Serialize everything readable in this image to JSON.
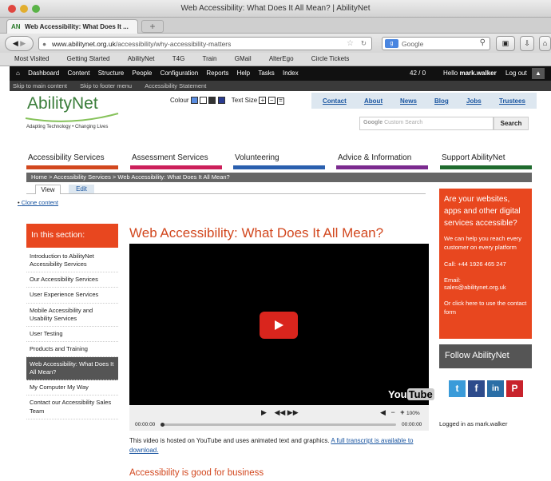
{
  "window": {
    "title": "Web Accessibility: What Does It All Mean? | AbilityNet",
    "tab_label": "Web Accessibility: What Does It ...",
    "tab_favicon": "AN"
  },
  "address": {
    "url_domain": "www.abilitynet.org.uk",
    "url_path": "/accessibility/why-accessibility-matters",
    "search_engine": "Google"
  },
  "bookmarks": [
    "Most Visited",
    "Getting Started",
    "AbilityNet",
    "T4G",
    "Train",
    "GMail",
    "AlterEgo",
    "Circle Tickets"
  ],
  "admin": {
    "items": [
      "Dashboard",
      "Content",
      "Structure",
      "People",
      "Configuration",
      "Reports",
      "Help",
      "Tasks",
      "Index"
    ],
    "counter": "42 / 0",
    "hello": "Hello",
    "user": "mark.walker",
    "logout": "Log out"
  },
  "skip": [
    "Skip to main content",
    "Skip to footer menu",
    "Accessibility Statement"
  ],
  "logo": {
    "name": "AbilityNet",
    "tagline": "Adapting Technology • Changing Lives"
  },
  "tools": {
    "colour": "Colour",
    "text_size": "Text Size"
  },
  "top_links": [
    "Contact",
    "About",
    "News",
    "Blog",
    "Jobs",
    "Trustees"
  ],
  "search": {
    "placeholder": "Custom Search",
    "button": "Search"
  },
  "main_nav": [
    {
      "label": "Accessibility Services",
      "color": "#d2471e"
    },
    {
      "label": "Assessment Services",
      "color": "#cc1f5a"
    },
    {
      "label": "Volunteering",
      "color": "#2a5fae"
    },
    {
      "label": "Advice & Information",
      "color": "#7b2a8f"
    },
    {
      "label": "Support AbilityNet",
      "color": "#1f6b2e"
    }
  ],
  "breadcrumb": "Home > Accessibility Services > Web Accessibility: What Does It All Mean?",
  "tabs": {
    "view": "View",
    "edit": "Edit"
  },
  "clone": "Clone content",
  "section": {
    "heading": "In this section:",
    "items": [
      "Introduction to AbilityNet Accessibility Services",
      "Our Accessibility Services",
      "User Experience Services",
      "Mobile Accessibility and Usability Services",
      "User Testing",
      "Products and Training",
      "Web Accessibility: What Does It All Mean?",
      "My Computer My Way",
      "Contact our Accessibility Sales Team"
    ],
    "active_index": 6
  },
  "article": {
    "title": "Web Accessibility: What Does It All Mean?",
    "video_note": "This video is hosted on YouTube and uses animated text and graphics.",
    "transcript_link": "A full transcript is available to download.",
    "subheading": "Accessibility is good for business"
  },
  "player": {
    "time_left": "00:00:00",
    "time_right": "00:00:00",
    "volume": "100%",
    "brand_you": "You",
    "brand_tube": "Tube"
  },
  "promo": {
    "heading": "Are your websites, apps and other digital services accessible?",
    "body": "We can help you reach every customer on every platform",
    "call": "Call: +44 1926 465 247",
    "email_label": "Email:",
    "email": "sales@abilitynet.org.uk",
    "contact": "Or click here to use the contact form"
  },
  "follow": {
    "heading": "Follow AbilityNet",
    "networks": [
      {
        "name": "twitter-icon",
        "glyph": "t",
        "color": "#3a9bd9"
      },
      {
        "name": "facebook-icon",
        "glyph": "f",
        "color": "#2d4b8c"
      },
      {
        "name": "linkedin-icon",
        "glyph": "in",
        "color": "#2a6ea6"
      },
      {
        "name": "pinterest-icon",
        "glyph": "P",
        "color": "#c8232c"
      }
    ]
  },
  "logged_in": "Logged in as mark.walker"
}
